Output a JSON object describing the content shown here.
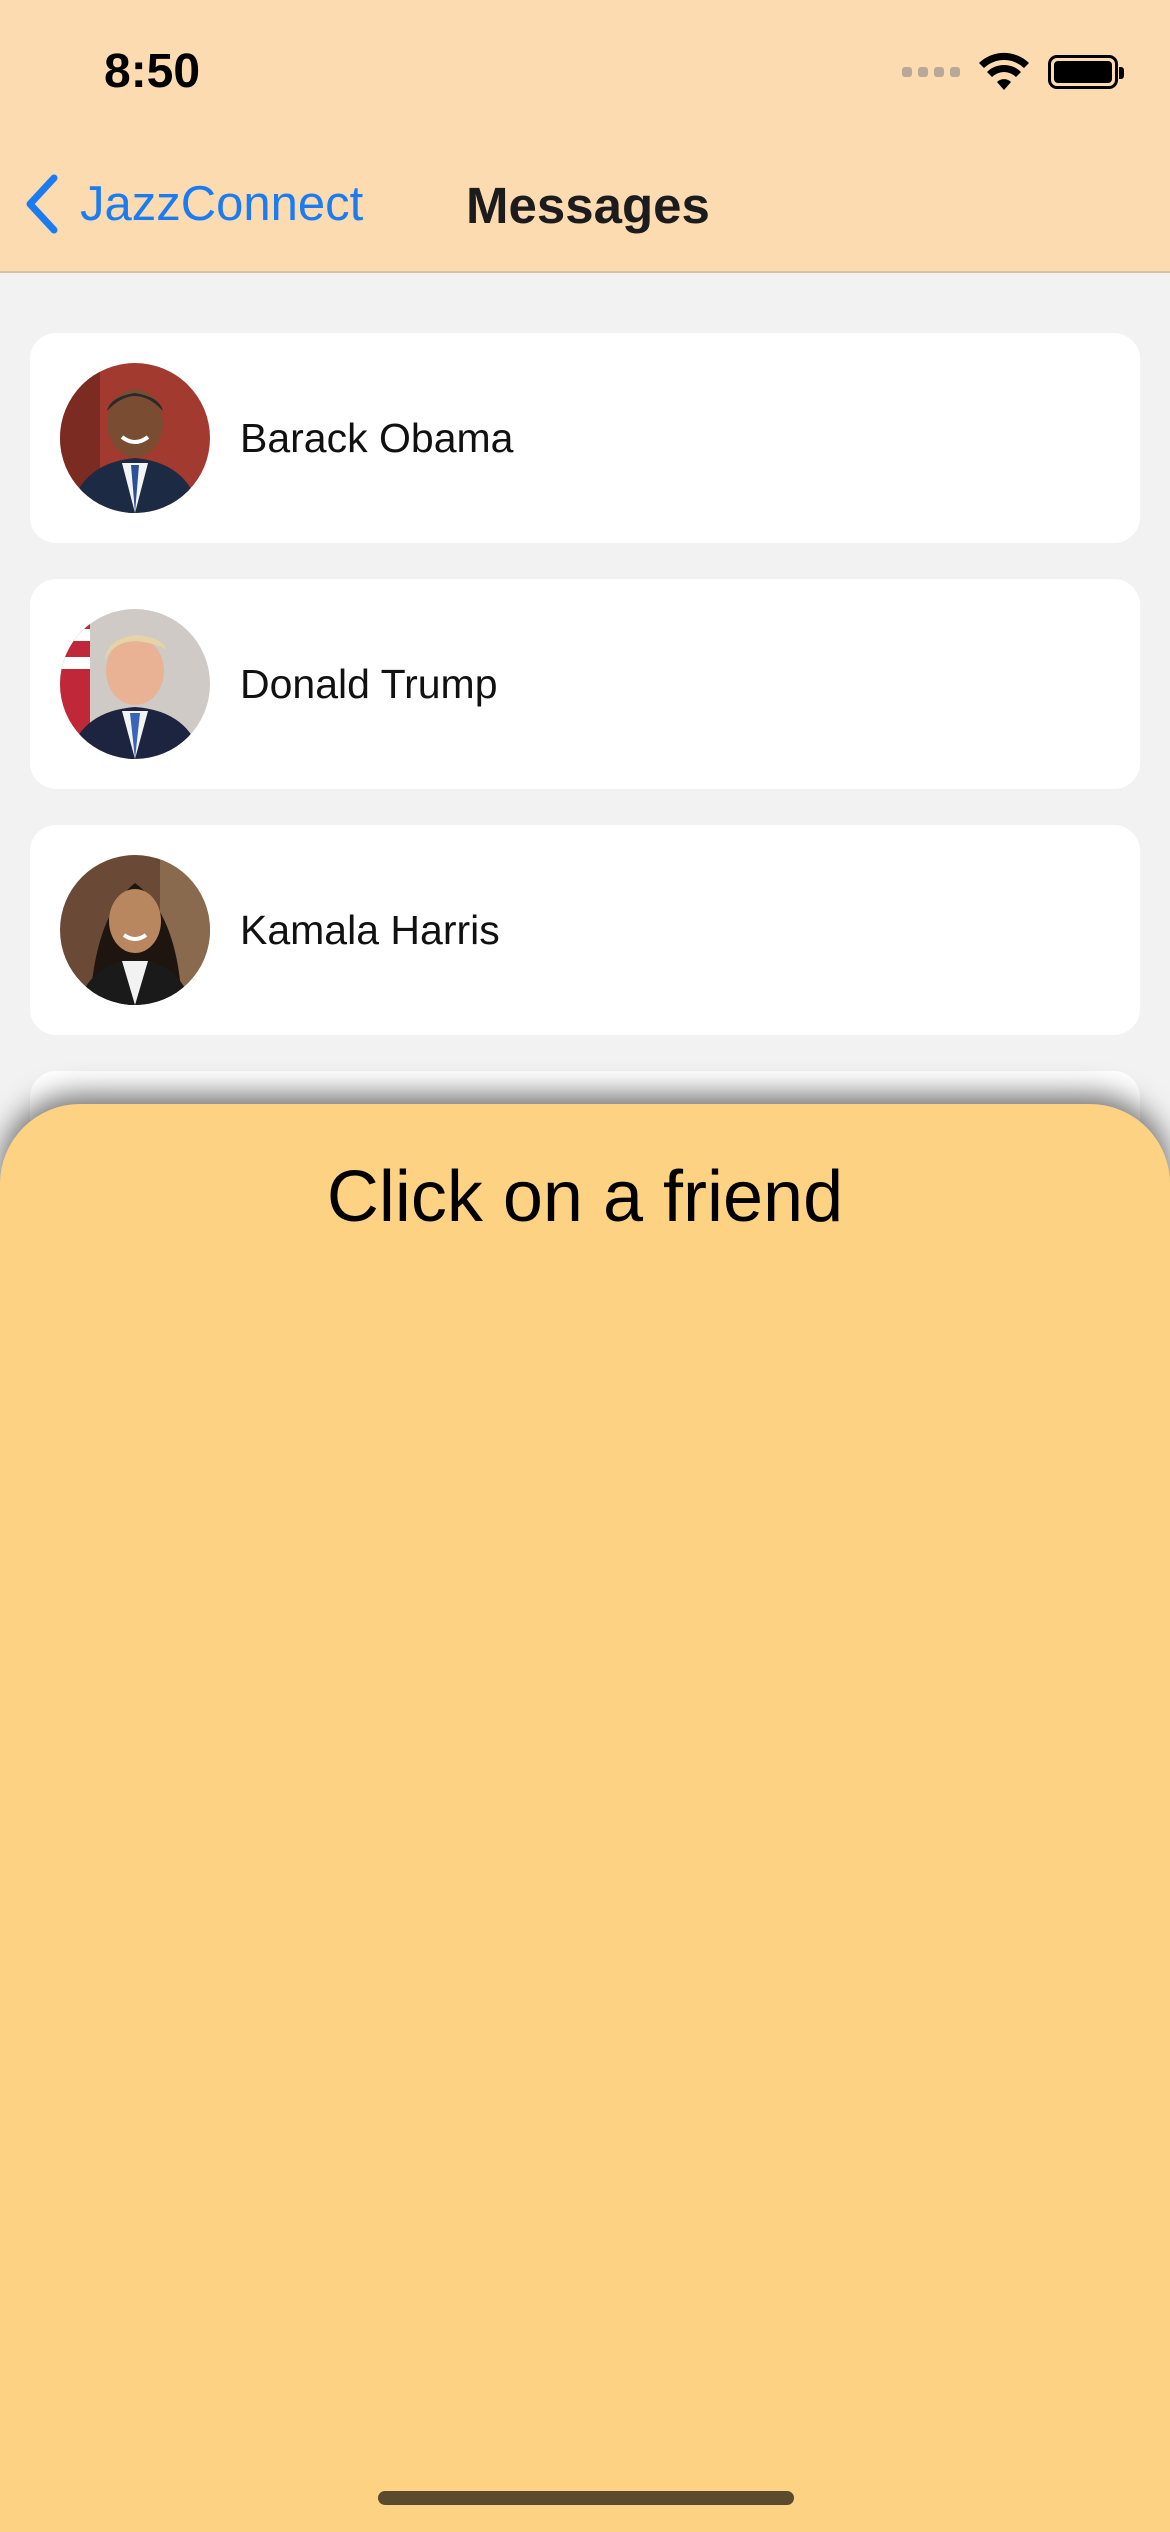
{
  "status_bar": {
    "time": "8:50"
  },
  "nav": {
    "back_label": "JazzConnect",
    "title": "Messages"
  },
  "friends": [
    {
      "name": "Barack Obama"
    },
    {
      "name": "Donald Trump"
    },
    {
      "name": "Kamala Harris"
    }
  ],
  "sheet": {
    "title": "Click on a friend"
  },
  "colors": {
    "header_bg": "#fddbb0",
    "accent": "#1a7cf0",
    "sheet_bg": "#fdd383",
    "list_bg": "#f2f2f2"
  }
}
